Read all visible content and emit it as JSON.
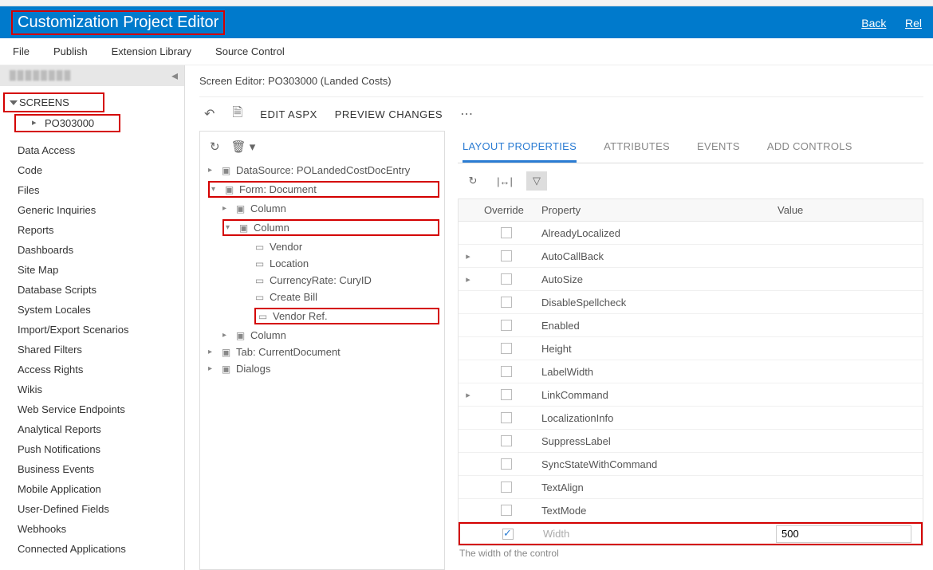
{
  "header": {
    "title": "Customization Project Editor",
    "back": "Back",
    "reload": "Rel"
  },
  "menu": {
    "file": "File",
    "publish": "Publish",
    "extlib": "Extension Library",
    "source": "Source Control"
  },
  "sidebar": {
    "screens": "SCREENS",
    "screen_item": "PO303000",
    "items": [
      "Data Access",
      "Code",
      "Files",
      "Generic Inquiries",
      "Reports",
      "Dashboards",
      "Site Map",
      "Database Scripts",
      "System Locales",
      "Import/Export Scenarios",
      "Shared Filters",
      "Access Rights",
      "Wikis",
      "Web Service Endpoints",
      "Analytical Reports",
      "Push Notifications",
      "Business Events",
      "Mobile Application",
      "User-Defined Fields",
      "Webhooks",
      "Connected Applications"
    ]
  },
  "main": {
    "crumb": "Screen Editor: PO303000 (Landed Costs)",
    "actions": {
      "edit": "EDIT ASPX",
      "preview": "PREVIEW CHANGES"
    },
    "tree": {
      "datasource": "DataSource: POLandedCostDocEntry",
      "form": "Form: Document",
      "column1": "Column",
      "column2": "Column",
      "vendor": "Vendor",
      "location": "Location",
      "currency": "CurrencyRate: CuryID",
      "createbill": "Create Bill",
      "vendorref": "Vendor Ref.",
      "column3": "Column",
      "tab": "Tab: CurrentDocument",
      "dialogs": "Dialogs"
    },
    "tabs": {
      "layout": "LAYOUT PROPERTIES",
      "attributes": "ATTRIBUTES",
      "events": "EVENTS",
      "addcontrols": "ADD CONTROLS"
    },
    "gridhead": {
      "override": "Override",
      "property": "Property",
      "value": "Value"
    },
    "rows": [
      {
        "exp": "",
        "ov": false,
        "prop": "AlreadyLocalized",
        "val": ""
      },
      {
        "exp": "▸",
        "ov": false,
        "prop": "AutoCallBack",
        "val": ""
      },
      {
        "exp": "▸",
        "ov": false,
        "prop": "AutoSize",
        "val": ""
      },
      {
        "exp": "",
        "ov": false,
        "prop": "DisableSpellcheck",
        "val": ""
      },
      {
        "exp": "",
        "ov": false,
        "prop": "Enabled",
        "val": ""
      },
      {
        "exp": "",
        "ov": false,
        "prop": "Height",
        "val": ""
      },
      {
        "exp": "",
        "ov": false,
        "prop": "LabelWidth",
        "val": ""
      },
      {
        "exp": "▸",
        "ov": false,
        "prop": "LinkCommand",
        "val": ""
      },
      {
        "exp": "",
        "ov": false,
        "prop": "LocalizationInfo",
        "val": ""
      },
      {
        "exp": "",
        "ov": false,
        "prop": "SuppressLabel",
        "val": ""
      },
      {
        "exp": "",
        "ov": false,
        "prop": "SyncStateWithCommand",
        "val": ""
      },
      {
        "exp": "",
        "ov": false,
        "prop": "TextAlign",
        "val": ""
      },
      {
        "exp": "",
        "ov": false,
        "prop": "TextMode",
        "val": ""
      },
      {
        "exp": "",
        "ov": true,
        "prop": "Width",
        "val": "500",
        "edit": true,
        "hl": true
      }
    ],
    "hint": "The width of the control"
  }
}
